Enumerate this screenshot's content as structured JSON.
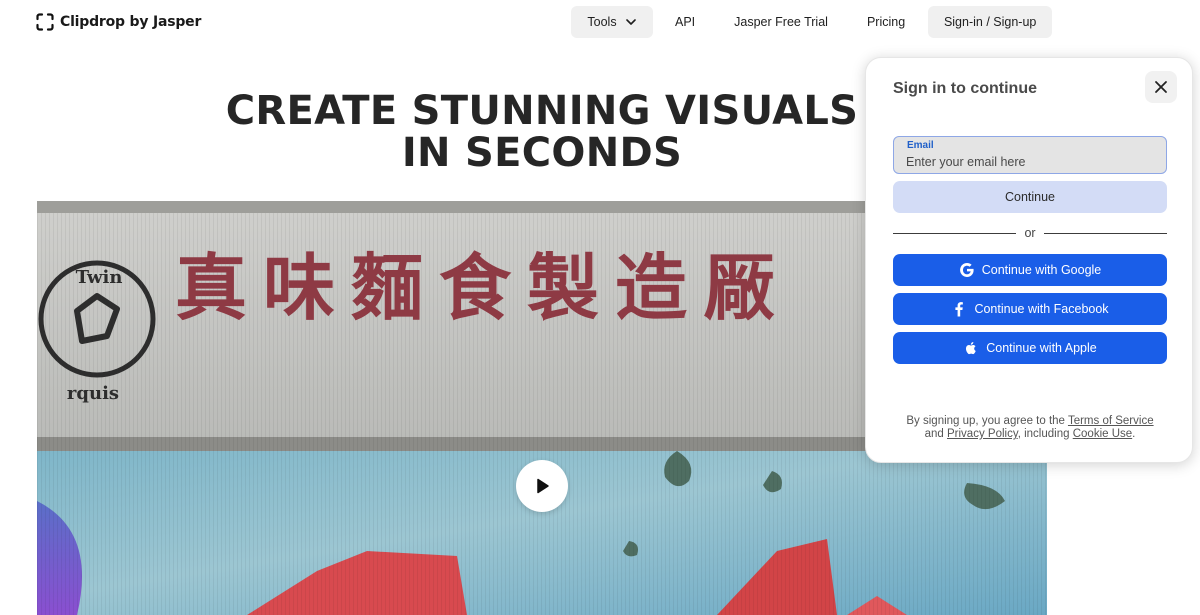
{
  "brand": {
    "name": "Clipdrop by Jasper"
  },
  "nav": {
    "tools": "Tools",
    "api": "API",
    "trial": "Jasper Free Trial",
    "pricing": "Pricing",
    "signin": "Sign-in / Sign-up"
  },
  "hero": {
    "line1": "CREATE STUNNING VISUALS",
    "line2": "IN SECONDS",
    "sign_text": "真味麵食製造厰",
    "stamp_top": "Twin",
    "stamp_bottom": "rquis"
  },
  "modal": {
    "title": "Sign in to continue",
    "email_label": "Email",
    "email_placeholder": "Enter your email here",
    "continue": "Continue",
    "or": "or",
    "google": "Continue with Google",
    "facebook": "Continue with Facebook",
    "apple": "Continue with Apple",
    "legal_prefix": "By signing up, you agree to the",
    "terms": "Terms of Service",
    "legal_and": "and",
    "privacy": "Privacy Policy",
    "legal_including": ", including",
    "cookie": "Cookie Use",
    "legal_end": "."
  },
  "colors": {
    "primary_button": "#1a5ee8",
    "continue_button": "#d3dcf6",
    "headline": "#262626"
  },
  "icons": [
    "brand-logo-icon",
    "chevron-down-icon",
    "play-icon",
    "close-icon",
    "google-icon",
    "facebook-icon",
    "apple-icon"
  ]
}
